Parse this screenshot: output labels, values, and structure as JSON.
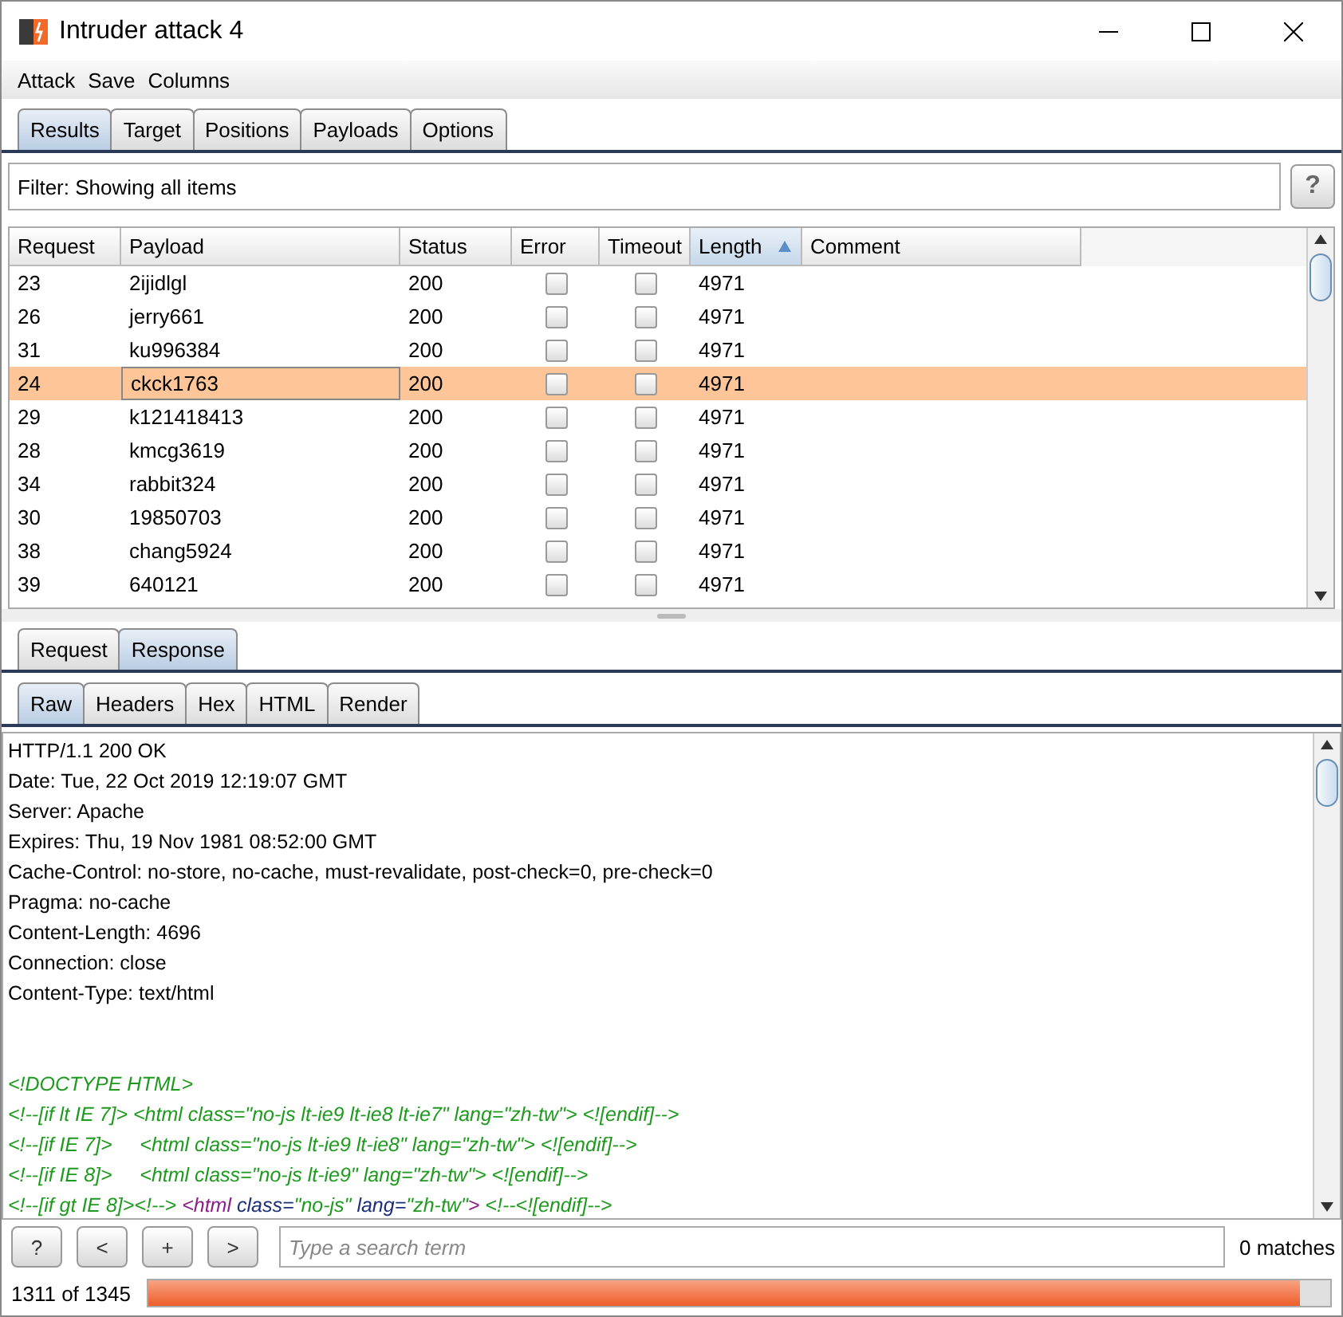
{
  "window": {
    "title": "Intruder attack 4"
  },
  "menu": [
    "Attack",
    "Save",
    "Columns"
  ],
  "tabs": [
    {
      "label": "Results",
      "selected": true
    },
    {
      "label": "Target",
      "selected": false
    },
    {
      "label": "Positions",
      "selected": false
    },
    {
      "label": "Payloads",
      "selected": false
    },
    {
      "label": "Options",
      "selected": false
    }
  ],
  "filter": {
    "text": "Filter: Showing all items",
    "help": "?"
  },
  "table": {
    "columns": [
      {
        "label": "Request",
        "sorted": false
      },
      {
        "label": "Payload",
        "sorted": false
      },
      {
        "label": "Status",
        "sorted": false
      },
      {
        "label": "Error",
        "sorted": false
      },
      {
        "label": "Timeout",
        "sorted": false
      },
      {
        "label": "Length",
        "sorted": true
      },
      {
        "label": "Comment",
        "sorted": false
      }
    ],
    "rows": [
      {
        "request": "23",
        "payload": "2ijidlgl",
        "status": "200",
        "error": false,
        "timeout": false,
        "length": "4971",
        "selected": false
      },
      {
        "request": "26",
        "payload": "jerry661",
        "status": "200",
        "error": false,
        "timeout": false,
        "length": "4971",
        "selected": false
      },
      {
        "request": "31",
        "payload": "ku996384",
        "status": "200",
        "error": false,
        "timeout": false,
        "length": "4971",
        "selected": false
      },
      {
        "request": "24",
        "payload": "ckck1763",
        "status": "200",
        "error": false,
        "timeout": false,
        "length": "4971",
        "selected": true
      },
      {
        "request": "29",
        "payload": "k121418413",
        "status": "200",
        "error": false,
        "timeout": false,
        "length": "4971",
        "selected": false
      },
      {
        "request": "28",
        "payload": "kmcg3619",
        "status": "200",
        "error": false,
        "timeout": false,
        "length": "4971",
        "selected": false
      },
      {
        "request": "34",
        "payload": "rabbit324",
        "status": "200",
        "error": false,
        "timeout": false,
        "length": "4971",
        "selected": false
      },
      {
        "request": "30",
        "payload": "19850703",
        "status": "200",
        "error": false,
        "timeout": false,
        "length": "4971",
        "selected": false
      },
      {
        "request": "38",
        "payload": "chang5924",
        "status": "200",
        "error": false,
        "timeout": false,
        "length": "4971",
        "selected": false
      },
      {
        "request": "39",
        "payload": "640121",
        "status": "200",
        "error": false,
        "timeout": false,
        "length": "4971",
        "selected": false
      }
    ]
  },
  "message_tabs": [
    {
      "label": "Request",
      "selected": false
    },
    {
      "label": "Response",
      "selected": true
    }
  ],
  "view_tabs": [
    {
      "label": "Raw",
      "selected": true
    },
    {
      "label": "Headers",
      "selected": false
    },
    {
      "label": "Hex",
      "selected": false
    },
    {
      "label": "HTML",
      "selected": false
    },
    {
      "label": "Render",
      "selected": false
    }
  ],
  "response_headers": [
    "HTTP/1.1 200 OK",
    "Date: Tue, 22 Oct 2019 12:19:07 GMT",
    "Server: Apache",
    "Expires: Thu, 19 Nov 1981 08:52:00 GMT",
    "Cache-Control: no-store, no-cache, must-revalidate, post-check=0, pre-check=0",
    "Pragma: no-cache",
    "Content-Length: 4696",
    "Connection: close",
    "Content-Type: text/html"
  ],
  "response_body": [
    [
      {
        "text": "<!DOCTYPE HTML>",
        "kind": "comment"
      }
    ],
    [
      {
        "text": "<!--[if lt IE 7]> <html class=\"no-js lt-ie9 lt-ie8 lt-ie7\" lang=\"zh-tw\"> <![endif]-->",
        "kind": "comment"
      }
    ],
    [
      {
        "text": "<!--[if IE 7]>     <html class=\"no-js lt-ie9 lt-ie8\" lang=\"zh-tw\"> <![endif]-->",
        "kind": "comment"
      }
    ],
    [
      {
        "text": "<!--[if IE 8]>     <html class=\"no-js lt-ie9\" lang=\"zh-tw\"> <![endif]-->",
        "kind": "comment"
      }
    ],
    [
      {
        "text": "<!--[if gt IE 8]><!-->",
        "kind": "comment"
      },
      {
        "text": " <html",
        "kind": "tag"
      },
      {
        "text": " class=",
        "kind": "attr"
      },
      {
        "text": "\"no-js\"",
        "kind": "value"
      },
      {
        "text": " lang=",
        "kind": "attr"
      },
      {
        "text": "\"zh-tw\"",
        "kind": "value"
      },
      {
        "text": ">",
        "kind": "tag"
      },
      {
        "text": " <!--<![endif]-->",
        "kind": "comment"
      }
    ]
  ],
  "search": {
    "help": "?",
    "prev": "<",
    "add": "+",
    "next": ">",
    "placeholder": "Type a search term",
    "matches": "0 matches"
  },
  "status": {
    "text": "1311 of 1345",
    "level": 0.975
  }
}
